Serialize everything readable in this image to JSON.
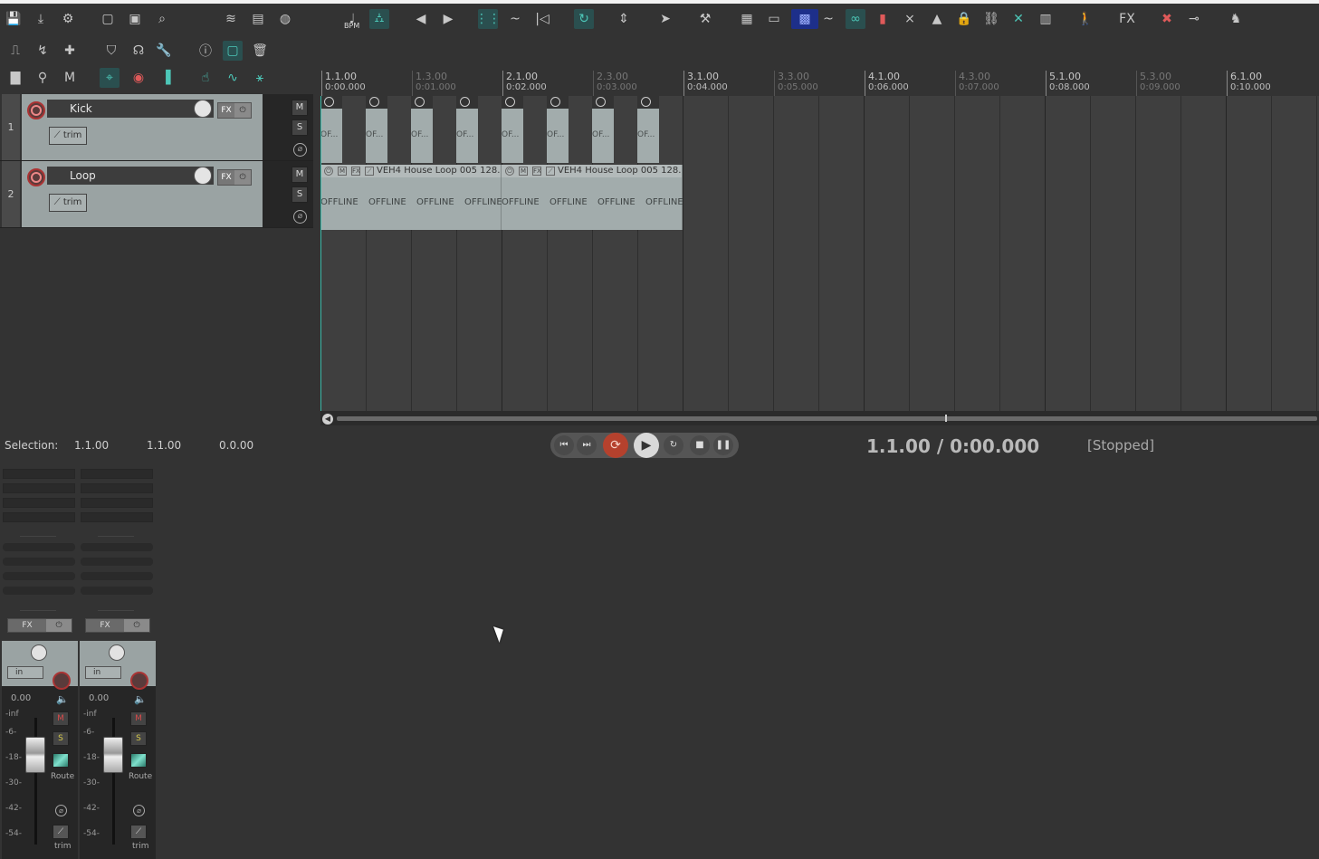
{
  "toolbar": {
    "row1": [
      {
        "icon": "save-icon",
        "glyph": "💾"
      },
      {
        "icon": "render-icon",
        "glyph": "⤓"
      },
      {
        "icon": "project-settings-icon",
        "glyph": "⚙"
      },
      {
        "icon": "new-project-icon",
        "glyph": "▢"
      },
      {
        "icon": "open-project-icon",
        "glyph": "▣"
      },
      {
        "icon": "project-browser-icon",
        "glyph": "⌕"
      },
      {
        "icon": "ripple-edit-icon",
        "glyph": "≋"
      },
      {
        "icon": "media-explorer-icon",
        "glyph": "▤"
      },
      {
        "icon": "drum-icon",
        "glyph": "◍"
      },
      {
        "icon": "bpm-icon",
        "glyph": "♩",
        "label": "BPM"
      },
      {
        "icon": "metronome-icon",
        "glyph": "⛼"
      },
      {
        "icon": "previous-marker-icon",
        "glyph": "◀"
      },
      {
        "icon": "next-marker-icon",
        "glyph": "▶"
      },
      {
        "icon": "grid-icon",
        "glyph": "⋮⋮"
      },
      {
        "icon": "swing-icon",
        "glyph": "~"
      },
      {
        "icon": "snap-icon",
        "glyph": "|◁"
      },
      {
        "icon": "loop-icon",
        "glyph": "↻"
      },
      {
        "icon": "zoom-icon",
        "glyph": "⇕"
      },
      {
        "icon": "pointer-icon",
        "glyph": "➤"
      },
      {
        "icon": "hammer-icon",
        "glyph": "⚒"
      },
      {
        "icon": "grid-lines-icon",
        "glyph": "▦"
      },
      {
        "icon": "media-item-icon",
        "glyph": "▭"
      },
      {
        "icon": "fx-chain-icon",
        "glyph": "▩"
      },
      {
        "icon": "envelope-icon",
        "glyph": "~"
      },
      {
        "icon": "link-icon",
        "glyph": "∞"
      },
      {
        "icon": "marker-icon",
        "glyph": "▮"
      },
      {
        "icon": "crossfade-icon",
        "glyph": "⨯"
      },
      {
        "icon": "picture-icon",
        "glyph": "▲"
      },
      {
        "icon": "lock-icon",
        "glyph": "🔒"
      },
      {
        "icon": "chain-icon",
        "glyph": "⛓"
      },
      {
        "icon": "auto-crossfade-icon",
        "glyph": "✕"
      },
      {
        "icon": "loop-slots-icon",
        "glyph": "▥"
      },
      {
        "icon": "walk-icon",
        "glyph": "🚶"
      },
      {
        "icon": "fx-play-icon",
        "glyph": "FX"
      },
      {
        "icon": "bypass-icon",
        "glyph": "✖"
      },
      {
        "icon": "plug-icon",
        "glyph": "⊸"
      },
      {
        "icon": "monitor-icon",
        "glyph": "♞"
      }
    ],
    "row2": [
      {
        "icon": "edit-envelope-icon",
        "glyph": "⎍"
      },
      {
        "icon": "envelope-points-icon",
        "glyph": "↯"
      },
      {
        "icon": "add-icon",
        "glyph": "✚"
      },
      {
        "icon": "shield-icon",
        "glyph": "⛉"
      },
      {
        "icon": "headphone-icon",
        "glyph": "☊"
      },
      {
        "icon": "wrench-icon",
        "glyph": "🔧"
      },
      {
        "icon": "info-icon",
        "glyph": "ⓘ"
      },
      {
        "icon": "copy-icon",
        "glyph": "▢"
      },
      {
        "icon": "trash-icon",
        "glyph": "🗑"
      }
    ],
    "row3": [
      {
        "icon": "color-icon",
        "glyph": "▇"
      },
      {
        "icon": "magnify-icon",
        "glyph": "⚲"
      },
      {
        "icon": "marquee-icon",
        "glyph": "M"
      },
      {
        "icon": "routing-icon",
        "glyph": "⌖"
      },
      {
        "icon": "record-arm-icon",
        "glyph": "◉"
      },
      {
        "icon": "meters-icon",
        "glyph": "▐"
      },
      {
        "icon": "hand-icon",
        "glyph": "☝"
      },
      {
        "icon": "curve-icon",
        "glyph": "∿"
      },
      {
        "icon": "node-icon",
        "glyph": "⚹"
      }
    ]
  },
  "tracks": [
    {
      "number": "1",
      "name": "Kick",
      "fx": "FX",
      "trim": "trim",
      "mute": "M",
      "solo": "S"
    },
    {
      "number": "2",
      "name": "Loop",
      "fx": "FX",
      "trim": "trim",
      "mute": "M",
      "solo": "S"
    }
  ],
  "ruler": [
    {
      "bar": "1.1.00",
      "time": "0:00.000",
      "major": true
    },
    {
      "bar": "1.3.00",
      "time": "0:01.000",
      "major": false
    },
    {
      "bar": "2.1.00",
      "time": "0:02.000",
      "major": true
    },
    {
      "bar": "2.3.00",
      "time": "0:03.000",
      "major": false
    },
    {
      "bar": "3.1.00",
      "time": "0:04.000",
      "major": true
    },
    {
      "bar": "3.3.00",
      "time": "0:05.000",
      "major": false
    },
    {
      "bar": "4.1.00",
      "time": "0:06.000",
      "major": true
    },
    {
      "bar": "4.3.00",
      "time": "0:07.000",
      "major": false
    },
    {
      "bar": "5.1.00",
      "time": "0:08.000",
      "major": true
    },
    {
      "bar": "5.3.00",
      "time": "0:09.000",
      "major": false
    },
    {
      "bar": "6.1.00",
      "time": "0:10.000",
      "major": true
    }
  ],
  "kick_items": [
    "OF...",
    "OF...",
    "OF...",
    "OF...",
    "OF...",
    "OF...",
    "OF...",
    "OF..."
  ],
  "loop_items": [
    {
      "name": "VEH4 House Loop 005 128...",
      "segments": [
        "OFFLINE",
        "OFFLINE",
        "OFFLINE",
        "OFFLINE"
      ]
    },
    {
      "name": "VEH4 House Loop 005 128...",
      "segments": [
        "OFFLINE",
        "OFFLINE",
        "OFFLINE",
        "OFFLINE"
      ]
    }
  ],
  "item_buttons": {
    "mute": "M",
    "fx": "FX"
  },
  "selection": {
    "label": "Selection:",
    "start": "1.1.00",
    "end": "1.1.00",
    "length": "0.0.00"
  },
  "transport": {
    "buttons": {
      "go_start": "⏮",
      "go_end": "⏭",
      "record": "⟳",
      "play": "▶",
      "repeat": "↻",
      "stop": "■",
      "pause": "❚❚"
    },
    "position": "1.1.00 / 0:00.000",
    "status": "[Stopped]"
  },
  "mixer": {
    "strips": [
      {
        "fx": "FX",
        "input": "in",
        "volume": "0.00",
        "mute": "M",
        "solo": "S",
        "route": "Route",
        "trim": "trim"
      },
      {
        "fx": "FX",
        "input": "in",
        "volume": "0.00",
        "mute": "M",
        "solo": "S",
        "route": "Route",
        "trim": "trim"
      }
    ],
    "scale": [
      "-inf",
      "-6-",
      "-18-",
      "-30-",
      "-42-",
      "-54-"
    ]
  }
}
